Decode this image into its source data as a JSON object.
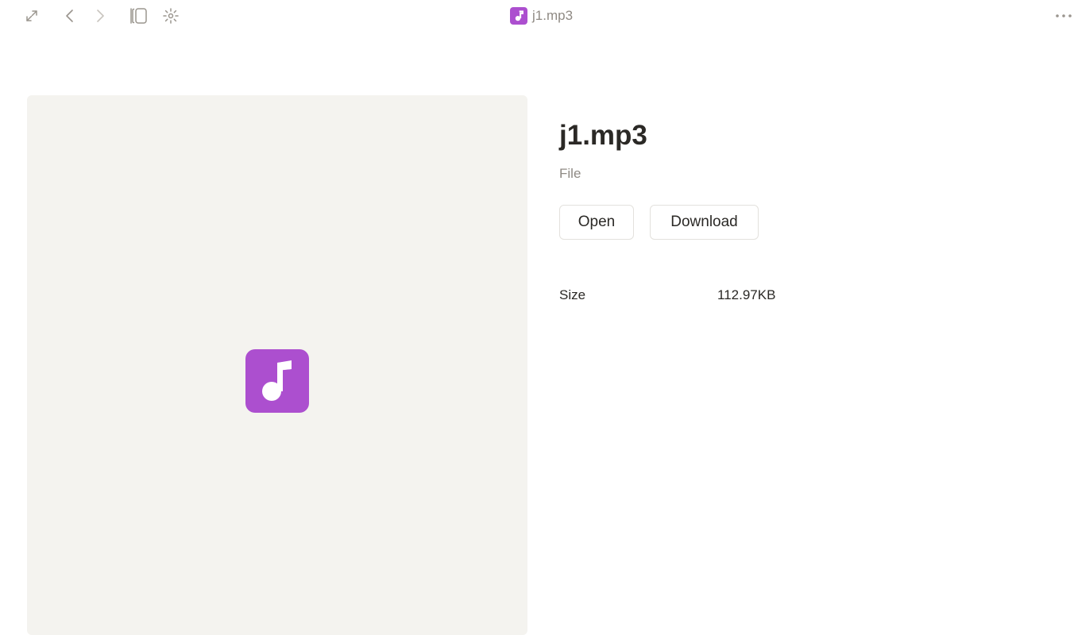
{
  "window": {
    "title": "j1.mp3"
  },
  "toolbar": {
    "icons": [
      "expand-icon",
      "back-icon",
      "forward-icon",
      "sidebar-toggle-icon",
      "loading-icon",
      "more-icon"
    ]
  },
  "file": {
    "name": "j1.mp3",
    "kind": "File",
    "icon": "music-note-icon",
    "icon_color": "#ac4fcf"
  },
  "actions": {
    "open_label": "Open",
    "download_label": "Download"
  },
  "metadata": {
    "size_label": "Size",
    "size_value": "112.97KB"
  },
  "colors": {
    "preview_bg": "#f4f3ef",
    "muted_text": "#8f8a84",
    "text": "#2b2926",
    "icon_gray": "#9a958e"
  }
}
